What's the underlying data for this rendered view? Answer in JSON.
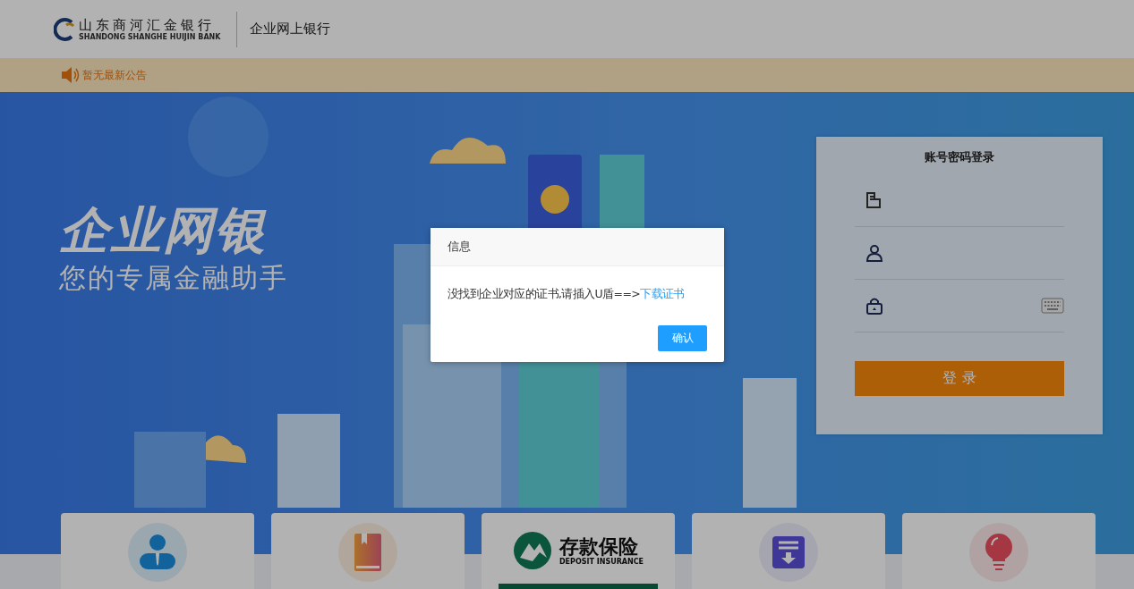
{
  "header": {
    "bank_name": "山东商河汇金银行",
    "bank_name_en": "SHANDONG SHANGHE HUIJIN BANK",
    "product": "企业网上银行"
  },
  "notice": {
    "text": "暂无最新公告"
  },
  "hero": {
    "title": "企业网银",
    "subtitle": "您的专属金融助手"
  },
  "login": {
    "title": "账号密码登录",
    "fields": [
      {
        "kind": "account"
      },
      {
        "kind": "user"
      },
      {
        "kind": "password"
      }
    ],
    "button": "登 录"
  },
  "cards": [
    {
      "kind": "user"
    },
    {
      "kind": "book"
    },
    {
      "kind": "deposit",
      "title": "存款保险",
      "subtitle": "DEPOSIT INSURANCE"
    },
    {
      "kind": "download"
    },
    {
      "kind": "bulb"
    }
  ],
  "dialog": {
    "title": "信息",
    "message": "没找到企业对应的证书,请插入U盾==>",
    "link": "下载证书",
    "button": "确认"
  }
}
